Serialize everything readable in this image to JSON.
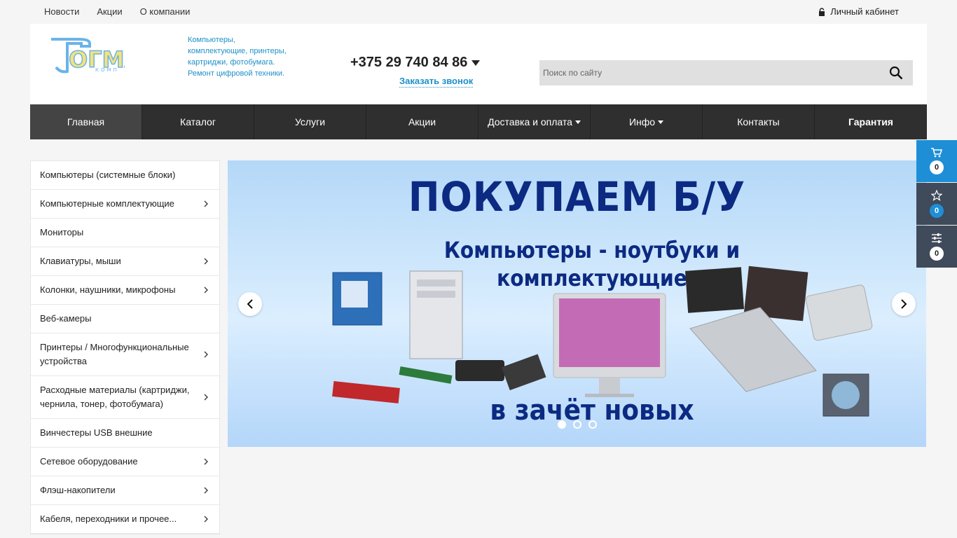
{
  "topbar": {
    "links": [
      "Новости",
      "Акции",
      "О компании"
    ],
    "account": "Личный кабинет"
  },
  "header": {
    "slogan_lines": [
      "Компьютеры,",
      "комплектующие, принтеры,",
      "картриджи, фотобумага.",
      "Ремонт цифровой техники."
    ],
    "phone": "+375 29 740 84 86",
    "callback": "Заказать звонок",
    "search_placeholder": "Поиск по сайту"
  },
  "nav": {
    "items": [
      "Главная",
      "Каталог",
      "Услуги",
      "Акции",
      "Доставка и оплата",
      "Инфо",
      "Контакты",
      "Гарантия"
    ]
  },
  "sidebar": {
    "categories": [
      {
        "label": "Компьютеры (системные блоки)",
        "has_sub": false
      },
      {
        "label": "Компьютерные комплектующие",
        "has_sub": true
      },
      {
        "label": "Мониторы",
        "has_sub": false
      },
      {
        "label": "Клавиатуры, мыши",
        "has_sub": true
      },
      {
        "label": "Колонки, наушники, микрофоны",
        "has_sub": true
      },
      {
        "label": "Веб-камеры",
        "has_sub": false
      },
      {
        "label": "Принтеры / Многофункциональные устройства",
        "has_sub": true
      },
      {
        "label": "Расходные материалы (картриджи, чернила, тонер, фотобумага)",
        "has_sub": true
      },
      {
        "label": "Винчестеры USB внешние",
        "has_sub": false
      },
      {
        "label": "Сетевое оборудование",
        "has_sub": true
      },
      {
        "label": "Флэш-накопители",
        "has_sub": true
      },
      {
        "label": "Кабеля, переходники и прочее...",
        "has_sub": true
      }
    ]
  },
  "slider": {
    "headline": "ПОКУПАЕМ Б/У",
    "sub_lines": [
      "Компьютеры - ноутбуки и",
      "комплектующие"
    ],
    "bottom": "в зачёт новых",
    "active_slide": 1,
    "slides_count": 3
  },
  "fixbar": {
    "cart_count": "0",
    "favorites_count": "0",
    "compare_count": "0"
  },
  "colors": {
    "accent": "#1e8fd6",
    "nav_bg": "#2f2f2f",
    "slogan": "#1e90c8",
    "banner_text": "#0c2a82"
  }
}
